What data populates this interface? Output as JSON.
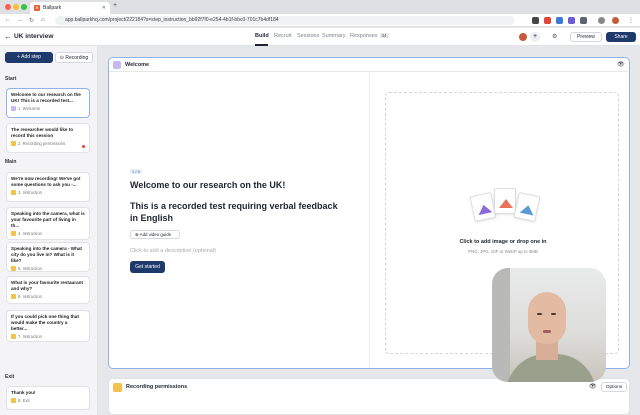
{
  "browser": {
    "tab_title": "Ballpark",
    "new_tab": "+",
    "url": "app.ballparkhq.com/project/222184?s=step_instruction_bb92f7f0-e254-4b1f-bbc0-701c7b4df184"
  },
  "header": {
    "project_title": "UK interview",
    "tabs": [
      "Build",
      "Recruit",
      "Sessions",
      "Summary",
      "Responses"
    ],
    "responses_badge": "34",
    "preview_label": "Preview",
    "share_label": "Share"
  },
  "sidebar": {
    "add_step_label": "Add step",
    "recording_label": "Recording",
    "sections": {
      "start": "Start",
      "main": "Main",
      "exit": "Exit"
    },
    "cards": [
      {
        "text": "Welcome to our research on the UK! This is a recorded test...",
        "type": "1. Welcome",
        "icon": "welcome-icon"
      },
      {
        "text": "The researcher would like to record this session",
        "type": "2. Recording permissions",
        "icon": "recording-icon"
      },
      {
        "text": "We're now recording! We've got some questions to ask you -...",
        "type": "3. Instruction",
        "icon": "instruction-icon"
      },
      {
        "text": "Speaking into the camera, what is your favourite part of living in th...",
        "type": "4. Instruction",
        "icon": "instruction-icon"
      },
      {
        "text": "Speaking into the camera - What city do you live in? What is it like?",
        "type": "5. Instruction",
        "icon": "instruction-icon"
      },
      {
        "text": "What is your favourite restaurant and why?",
        "type": "6. Instruction",
        "icon": "instruction-icon"
      },
      {
        "text": "If you could pick one thing that would make the country a better...",
        "type": "7. Instruction",
        "icon": "instruction-icon"
      },
      {
        "text": "Thank you!",
        "type": "8. Exit",
        "icon": "exit-icon"
      }
    ]
  },
  "panel": {
    "title": "Welcome",
    "step_number": "1 / 8",
    "heading": "Welcome to our research on the UK!",
    "subheading": "This is a recorded test requiring verbal feedback in English",
    "add_video_label": "Add video guide",
    "description_placeholder": "Click to add a description (optional)",
    "get_started_label": "Get started",
    "drop_title": "Click to add image or drop one in",
    "drop_subtitle": "PNG, JPG, GIF or WebP up to 5MB"
  },
  "panel2": {
    "title": "Recording permissions",
    "options_label": "Options"
  },
  "colors": {
    "primary": "#1e3a6b",
    "selected_border": "#8fb3e8",
    "welcome_icon": "#c9b8ee",
    "instruction_icon": "#f2c14e"
  }
}
